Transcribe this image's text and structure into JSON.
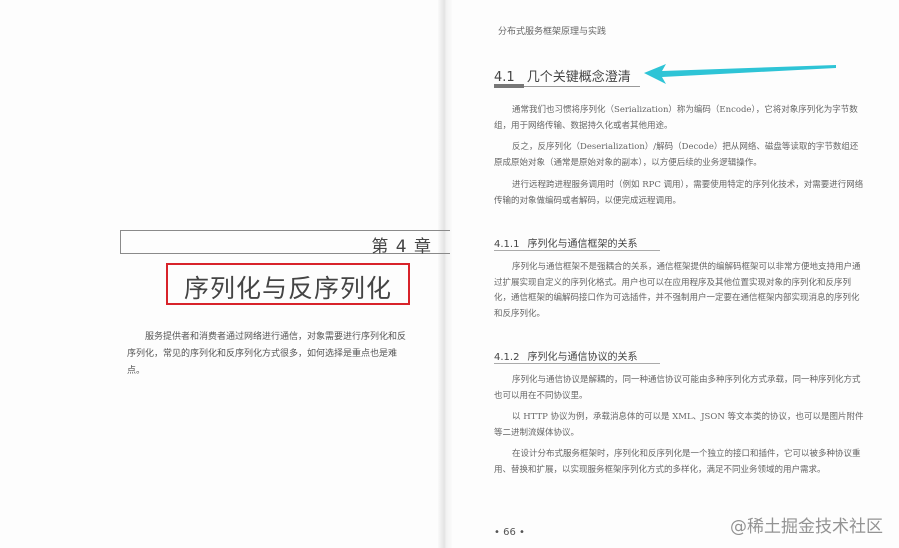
{
  "left_page": {
    "chapter_number": "第 4 章",
    "chapter_title": "序列化与反序列化",
    "intro": "服务提供者和消费者通过网络进行通信，对象需要进行序列化和反序列化，常见的序列化和反序列化方式很多，如何选择是重点也是难点。"
  },
  "right_page": {
    "running_head": "分布式服务框架原理与实践",
    "section": {
      "number": "4.1",
      "title": "几个关键概念澄清"
    },
    "section_paragraphs": [
      "通常我们也习惯将序列化（Serialization）称为编码（Encode），它将对象序列化为字节数组，用于网络传输、数据持久化或者其他用途。",
      "反之，反序列化（Deserialization）/解码（Decode）把从网络、磁盘等读取的字节数组还原成原始对象（通常是原始对象的副本），以方便后续的业务逻辑操作。",
      "进行远程跨进程服务调用时（例如 RPC 调用），需要使用特定的序列化技术，对需要进行网络传输的对象做编码或者解码，以便完成远程调用。"
    ],
    "subsection_1": {
      "number": "4.1.1",
      "title": "序列化与通信框架的关系",
      "paragraphs": [
        "序列化与通信框架不是强耦合的关系，通信框架提供的编解码框架可以非常方便地支持用户通过扩展实现自定义的序列化格式。用户也可以在应用程序及其他位置实现对象的序列化和反序列化，通信框架的编解码接口作为可选插件，并不强制用户一定要在通信框架内部实现消息的序列化和反序列化。"
      ]
    },
    "subsection_2": {
      "number": "4.1.2",
      "title": "序列化与通信协议的关系",
      "paragraphs": [
        "序列化与通信协议是解耦的，同一种通信协议可能由多种序列化方式承载，同一种序列化方式也可以用在不同协议里。",
        "以 HTTP 协议为例，承载消息体的可以是 XML、JSON 等文本类的协议，也可以是图片附件等二进制流媒体协议。",
        "在设计分布式服务框架时，序列化和反序列化是一个独立的接口和插件，它可以被多种协议重用、替换和扩展，以实现服务框架序列化方式的多样化，满足不同业务领域的用户需求。"
      ]
    },
    "page_number": "• 66 •"
  },
  "watermark": "@稀土掘金技术社区",
  "colors": {
    "highlight_box": "#d8232a",
    "arrow": "#2ec4d6"
  }
}
